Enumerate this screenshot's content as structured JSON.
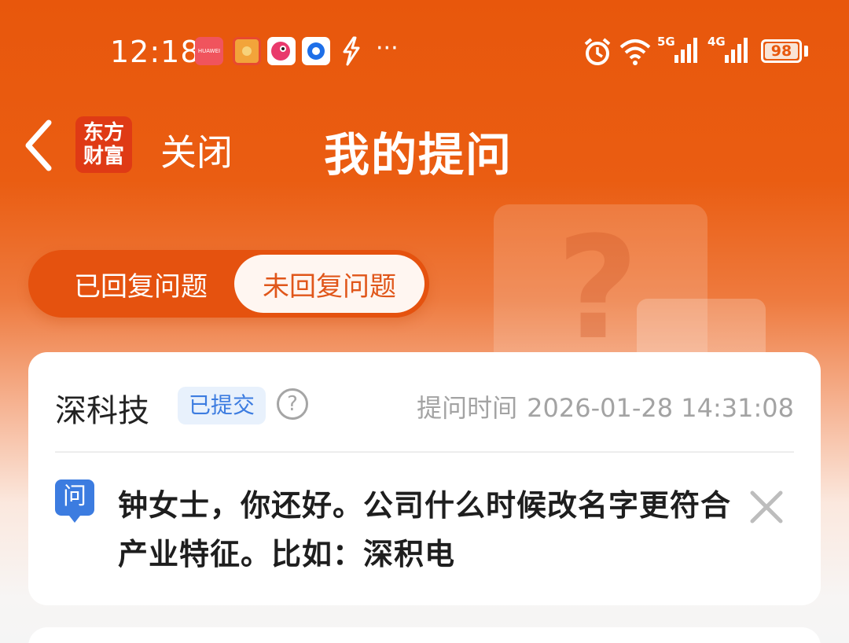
{
  "status_bar": {
    "time": "12:18",
    "icons": [
      "huawei-appgallery-icon",
      "red-envelope-icon",
      "bird-app-icon",
      "blue-ring-app-icon",
      "lightning-icon",
      "more-dots-icon",
      "alarm-icon",
      "wifi-icon",
      "signal-5g-icon",
      "signal-4g-icon"
    ],
    "huawei_label": "HUAWEI",
    "more": "···",
    "net1": "5G",
    "net2": "4G",
    "battery": "98"
  },
  "header": {
    "logo_line1": "东方",
    "logo_line2": "财富",
    "close_label": "关闭",
    "title": "我的提问"
  },
  "tabs": {
    "replied": "已回复问题",
    "unreplied": "未回复问题",
    "active": "unreplied"
  },
  "questions": [
    {
      "stock": "深科技",
      "status": "已提交",
      "help": "?",
      "time_label": "提问时间",
      "time": "2026-01-28 14:31:08",
      "badge": "问",
      "text": "钟女士，你还好。公司什么时候改名字更符合产业特征。比如：深积电"
    }
  ],
  "colors": {
    "brand_orange": "#E8570C",
    "badge_blue": "#3C7CE0",
    "logo_red": "#DF3A15"
  }
}
